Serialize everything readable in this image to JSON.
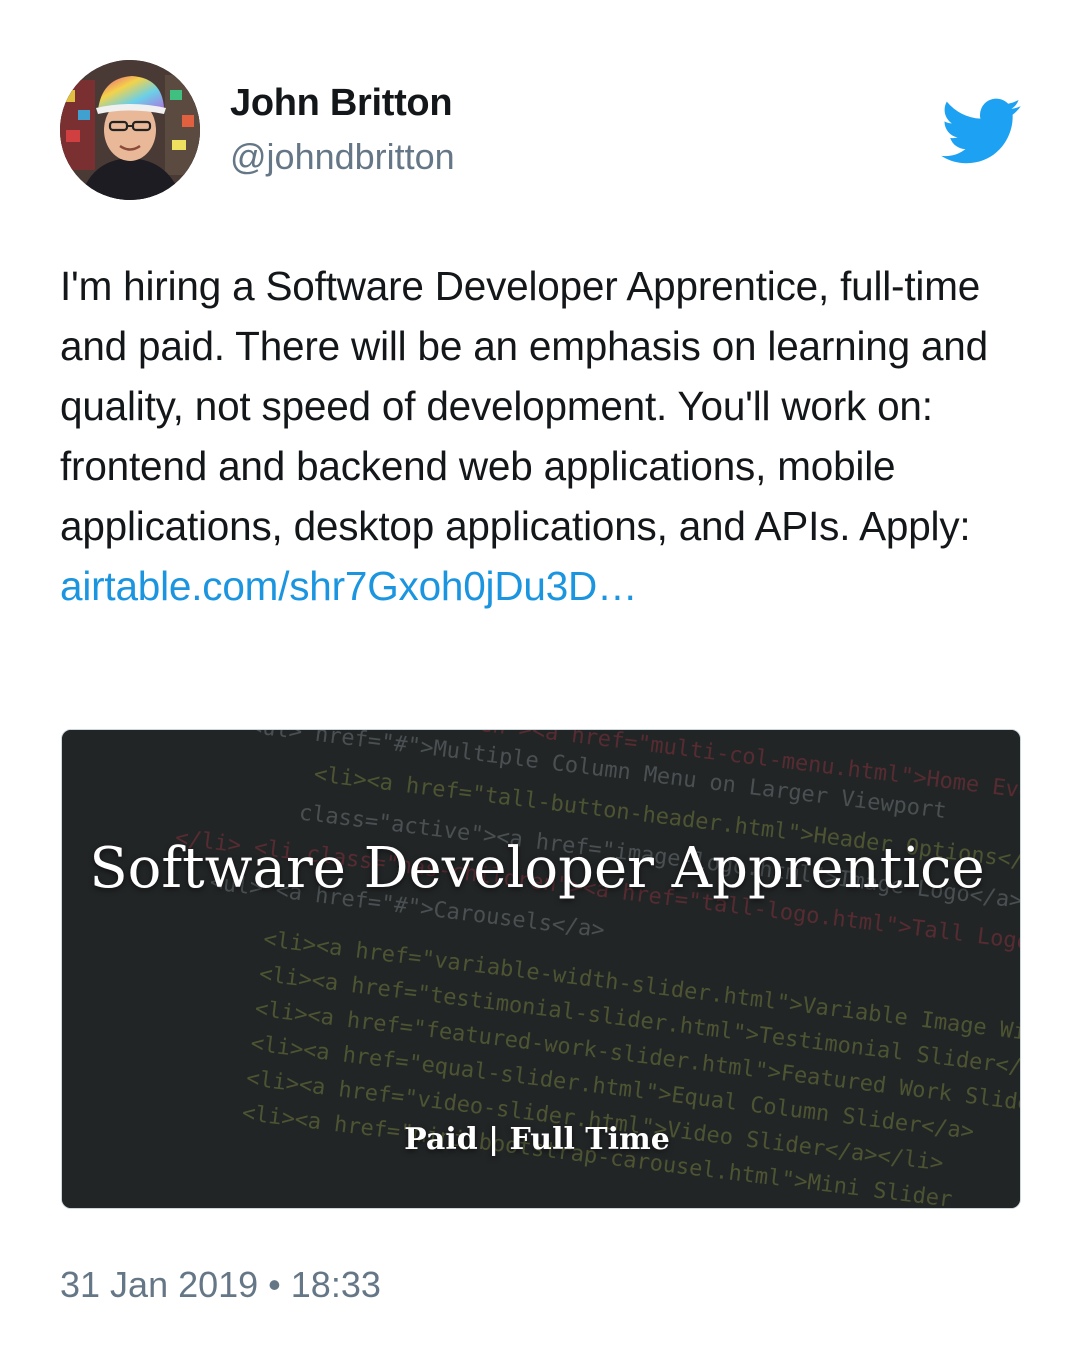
{
  "author": {
    "display_name": "John Britton",
    "username": "@johndbritton",
    "avatar_icon": "user-avatar"
  },
  "brand": {
    "icon": "twitter-bird-icon",
    "color": "#1DA1F2"
  },
  "tweet": {
    "text": "I'm hiring a Software Developer Apprentice, full-time and paid. There will be an emphasis on learning and quality, not speed of development. You'll work on: frontend and backend web applications, mobile applications, desktop applications, and APIs. Apply:",
    "link_text": "airtable.com/shr7Gxoh0jDu3D…",
    "link_color": "#1B95E0"
  },
  "card": {
    "title": "Software Developer Apprentice",
    "subtitle": "Paid | Full Time",
    "background": "code-editor-photo"
  },
  "meta": {
    "timestamp": "31 Jan 2019 • 18:33",
    "text_color": "#657786"
  }
}
